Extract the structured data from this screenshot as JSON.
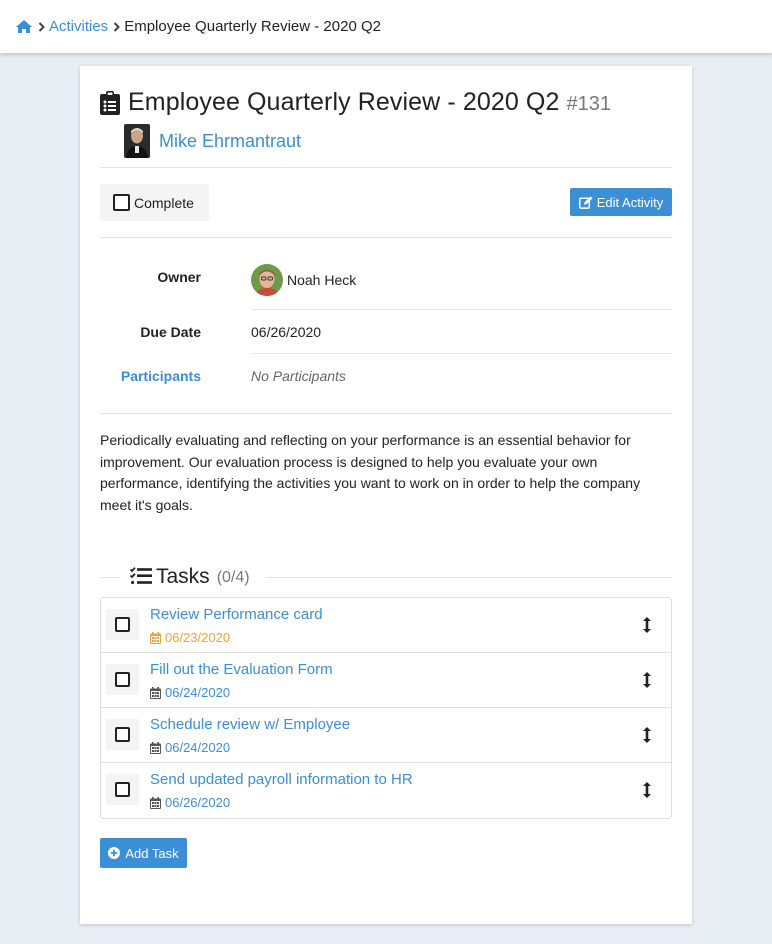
{
  "breadcrumb": {
    "home_icon": "home-icon",
    "items": [
      {
        "label": "Activities"
      },
      {
        "label": "Employee Quarterly Review - 2020 Q2"
      }
    ]
  },
  "activity": {
    "title": "Employee Quarterly Review - 2020 Q2",
    "id": "#131",
    "icon": "clipboard-list-icon",
    "person_name": "Mike Ehrmantraut"
  },
  "actions": {
    "complete_label": "Complete",
    "edit_label": "Edit Activity"
  },
  "details": {
    "owner_label": "Owner",
    "owner_name": "Noah Heck",
    "due_label": "Due Date",
    "due_value": "06/26/2020",
    "participants_label": "Participants",
    "participants_value": "No Participants"
  },
  "description": "Periodically evaluating and reflecting on your performance is an essential behavior for improvement. Our evaluation process is designed to help you evaluate your own performance, identifying the activities you want to work on in order to help the company meet it's goals.",
  "tasks": {
    "heading": "Tasks",
    "count_done": "0",
    "count_total": "4",
    "items": [
      {
        "title": "Review Performance card",
        "date": "06/23/2020",
        "overdue": true
      },
      {
        "title": "Fill out the Evaluation Form",
        "date": "06/24/2020",
        "overdue": false
      },
      {
        "title": "Schedule review w/ Employee",
        "date": "06/24/2020",
        "overdue": false
      },
      {
        "title": "Send updated payroll information to HR",
        "date": "06/26/2020",
        "overdue": false
      }
    ],
    "add_label": "Add Task"
  },
  "colors": {
    "accent": "#3a8fd6",
    "overdue": "#f0a23a",
    "page_background": "#e9eef5"
  }
}
